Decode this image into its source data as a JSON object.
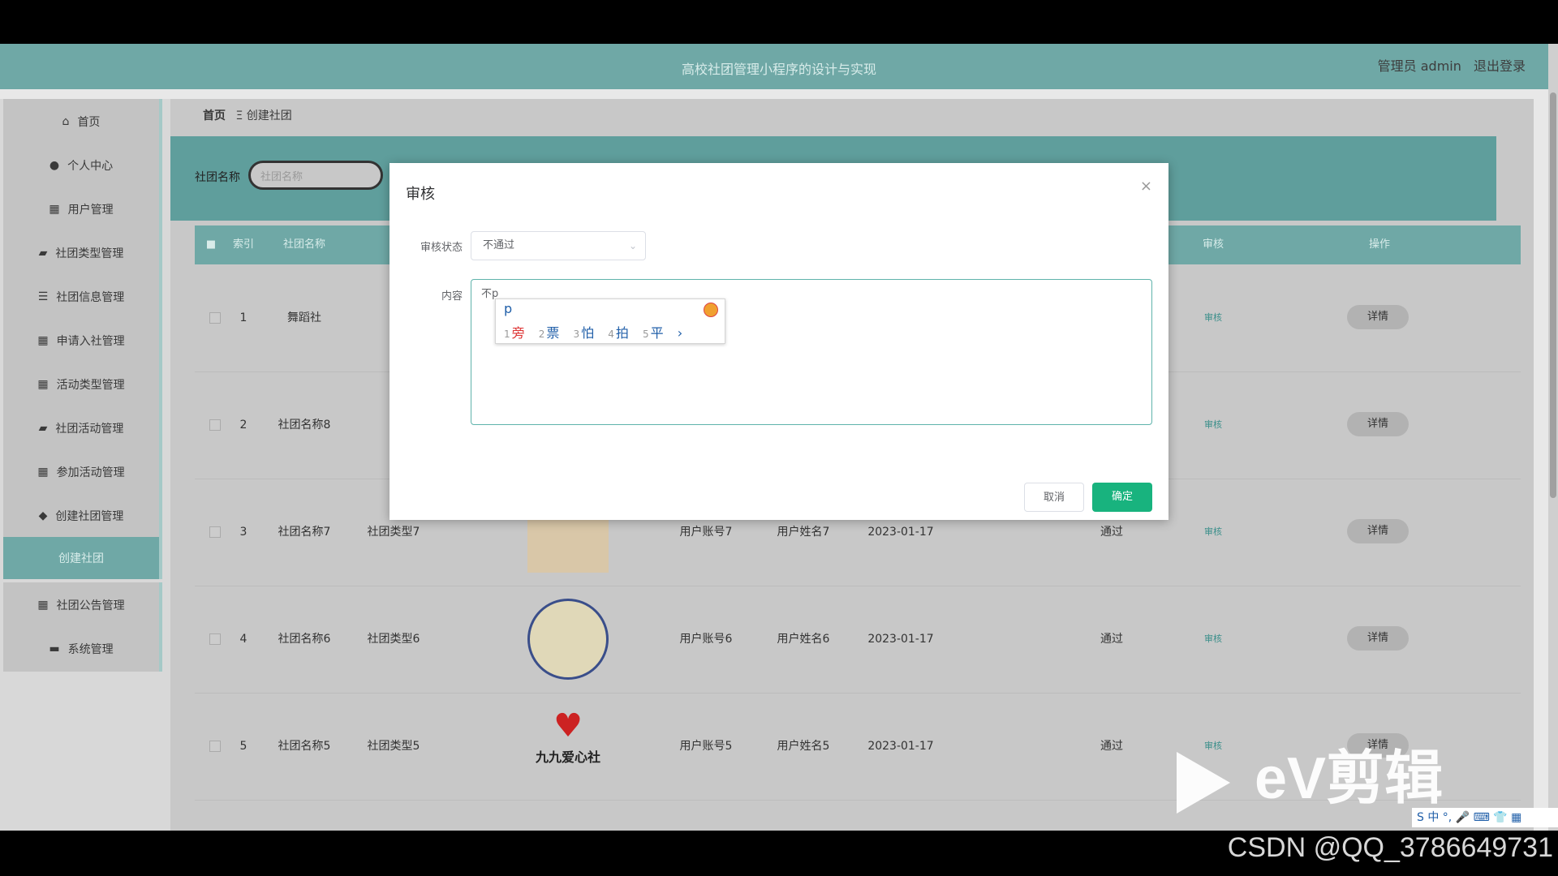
{
  "header": {
    "title": "高校社团管理小程序的设计与实现",
    "user": "管理员 admin",
    "logout": "退出登录"
  },
  "sidebar": {
    "items": [
      {
        "label": "首页",
        "icon": "home-icon",
        "glyph": "⌂"
      },
      {
        "label": "个人中心",
        "icon": "user-icon",
        "glyph": "●"
      },
      {
        "label": "用户管理",
        "icon": "grid-icon",
        "glyph": "▦"
      },
      {
        "label": "社团类型管理",
        "icon": "briefcase-icon",
        "glyph": "▰"
      },
      {
        "label": "社团信息管理",
        "icon": "list-icon",
        "glyph": "☰"
      },
      {
        "label": "申请入社管理",
        "icon": "grid-icon",
        "glyph": "▦"
      },
      {
        "label": "活动类型管理",
        "icon": "grid-icon",
        "glyph": "▦"
      },
      {
        "label": "社团活动管理",
        "icon": "briefcase-icon",
        "glyph": "▰"
      },
      {
        "label": "参加活动管理",
        "icon": "grid-icon",
        "glyph": "▦"
      },
      {
        "label": "创建社团管理",
        "icon": "pin-icon",
        "glyph": "◆"
      },
      {
        "label": "创建社团",
        "icon": "",
        "glyph": ""
      },
      {
        "label": "社团公告管理",
        "icon": "grid-icon",
        "glyph": "▦"
      },
      {
        "label": "系统管理",
        "icon": "monitor-icon",
        "glyph": "▬"
      }
    ]
  },
  "breadcrumb": {
    "home": "首页",
    "sep": "Ξ",
    "current": "创建社团"
  },
  "search": {
    "label": "社团名称",
    "placeholder": "社团名称"
  },
  "table": {
    "headers": [
      "索引",
      "社团名称",
      "审核",
      "操作"
    ],
    "rows": [
      {
        "index": "1",
        "name": "舞蹈社",
        "type": "",
        "account": "",
        "username": "",
        "date": "",
        "status": "",
        "audit": "审核",
        "action": "详情"
      },
      {
        "index": "2",
        "name": "社团名称8",
        "type": "",
        "account": "",
        "username": "",
        "date": "",
        "status": "",
        "audit": "审核",
        "action": "详情"
      },
      {
        "index": "3",
        "name": "社团名称7",
        "type": "社团类型7",
        "account": "用户账号7",
        "username": "用户姓名7",
        "date": "2023-01-17",
        "status": "通过",
        "audit": "审核",
        "action": "详情"
      },
      {
        "index": "4",
        "name": "社团名称6",
        "type": "社团类型6",
        "account": "用户账号6",
        "username": "用户姓名6",
        "date": "2023-01-17",
        "status": "通过",
        "audit": "审核",
        "action": "详情"
      },
      {
        "index": "5",
        "name": "社团名称5",
        "type": "社团类型5",
        "account": "用户账号5",
        "username": "用户姓名5",
        "date": "2023-01-17",
        "status": "通过",
        "audit": "审核",
        "action": "详情"
      }
    ],
    "logo_text": "九九爱心社"
  },
  "dialog": {
    "title": "审核",
    "close": "×",
    "status_label": "审核状态",
    "status_value": "不通过",
    "content_label": "内容",
    "content_value": "不p",
    "cancel": "取消",
    "confirm": "确定"
  },
  "ime": {
    "typed": "p",
    "candidates": [
      {
        "n": "1",
        "text": "旁"
      },
      {
        "n": "2",
        "text": "票"
      },
      {
        "n": "3",
        "text": "怕"
      },
      {
        "n": "4",
        "text": "拍"
      },
      {
        "n": "5",
        "text": "平"
      }
    ],
    "next": "›"
  },
  "overlays": {
    "ev_brand": "eV剪辑",
    "csdn": "CSDN @QQ_3786649731",
    "tray": "S 中 °, 🎤 ⌨ 👕 ▦"
  }
}
